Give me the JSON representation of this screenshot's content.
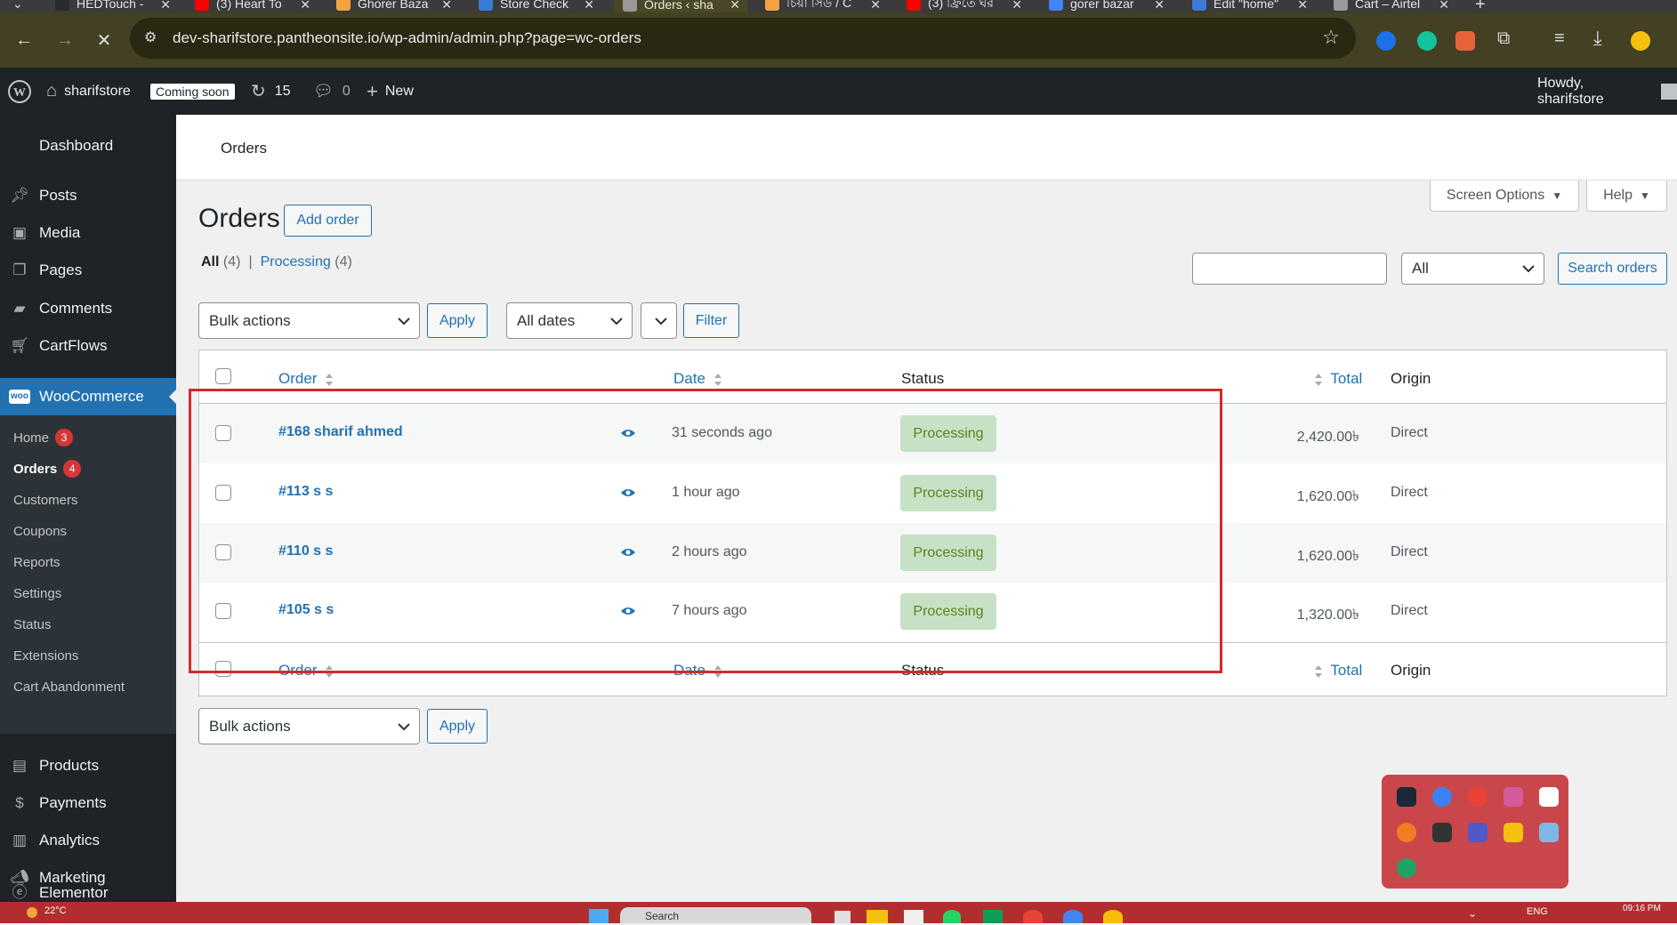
{
  "browser": {
    "tabs": [
      {
        "title": "HEDTouch -",
        "favicon_color": "#2b2b2b"
      },
      {
        "title": "(3) Heart To",
        "favicon_color": "#ff0000"
      },
      {
        "title": "Ghorer Baza",
        "favicon_color": "#f4a340"
      },
      {
        "title": "Store Check",
        "favicon_color": "#3a7bd5"
      },
      {
        "title": "Orders ‹ sha",
        "favicon_color": "#999999"
      },
      {
        "title": "চিয়া সিড / C",
        "favicon_color": "#f4a340"
      },
      {
        "title": "(3) ফ্রিতে ঘর",
        "favicon_color": "#ff0000"
      },
      {
        "title": "gorer bazar",
        "favicon_color": "#4285f4"
      },
      {
        "title": "Edit \"home\"",
        "favicon_color": "#3a7bd5"
      },
      {
        "title": "Cart – Airtel",
        "favicon_color": "#999999"
      }
    ],
    "url": "dev-sharifstore.pantheonsite.io/wp-admin/admin.php?page=wc-orders"
  },
  "adminbar": {
    "site_name": "sharifstore",
    "coming_soon": "Coming soon",
    "updates_count": "15",
    "comments_count": "0",
    "new_label": "New",
    "howdy": "Howdy, sharifstore"
  },
  "sidebar": {
    "dashboard": "Dashboard",
    "posts": "Posts",
    "media": "Media",
    "pages": "Pages",
    "comments": "Comments",
    "cartflows": "CartFlows",
    "woocommerce": "WooCommerce",
    "sub": {
      "home": "Home",
      "home_count": "3",
      "orders": "Orders",
      "orders_count": "4",
      "customers": "Customers",
      "coupons": "Coupons",
      "reports": "Reports",
      "settings": "Settings",
      "status": "Status",
      "extensions": "Extensions",
      "cart_abandonment": "Cart Abandonment"
    },
    "products": "Products",
    "payments": "Payments",
    "analytics": "Analytics",
    "marketing": "Marketing",
    "elementor": "Elementor"
  },
  "header": {
    "strip_title": "Orders",
    "screen_options": "Screen Options",
    "help": "Help"
  },
  "page": {
    "title": "Orders",
    "add_order": "Add order",
    "filter_all": "All",
    "filter_all_count": "(4)",
    "filter_sep": "|",
    "filter_processing": "Processing",
    "filter_processing_count": "(4)",
    "search_placeholder": "",
    "search_status_select": "All",
    "search_button": "Search orders",
    "bulk_actions": "Bulk actions",
    "apply": "Apply",
    "all_dates": "All dates",
    "filter_button": "Filter"
  },
  "table": {
    "col_order": "Order",
    "col_date": "Date",
    "col_status": "Status",
    "col_total": "Total",
    "col_origin": "Origin",
    "rows": [
      {
        "order": "#168 sharif ahmed",
        "date": "31 seconds ago",
        "status": "Processing",
        "total": "2,420.00৳",
        "origin": "Direct"
      },
      {
        "order": "#113 s s",
        "date": "1 hour ago",
        "status": "Processing",
        "total": "1,620.00৳",
        "origin": "Direct"
      },
      {
        "order": "#110 s s",
        "date": "2 hours ago",
        "status": "Processing",
        "total": "1,620.00৳",
        "origin": "Direct"
      },
      {
        "order": "#105 s s",
        "date": "7 hours ago",
        "status": "Processing",
        "total": "1,320.00৳",
        "origin": "Direct"
      }
    ]
  },
  "bottom": {
    "bulk_actions": "Bulk actions",
    "apply": "Apply"
  },
  "taskbar": {
    "weather": "22°C",
    "search": "Search",
    "lang": "ENG",
    "time": "09:16 PM"
  },
  "colors": {
    "highlight_box": "#d42a2a",
    "wp_blue": "#2271b1",
    "status_processing_bg": "#c6e1c6"
  }
}
